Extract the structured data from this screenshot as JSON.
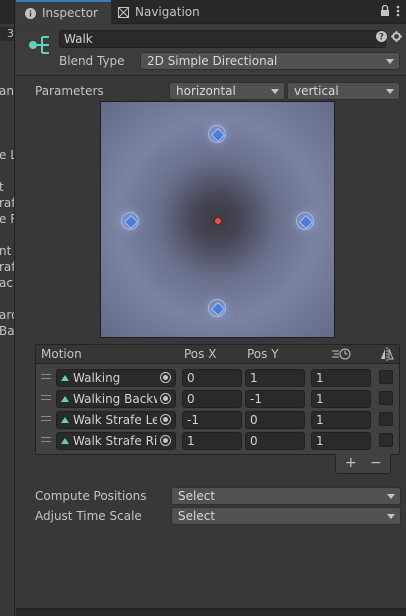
{
  "left_panel": {
    "number": "3",
    "fragments": [
      "and",
      "e L",
      "t",
      "rafe",
      "e R",
      "nt",
      "raf",
      "ack",
      "ard",
      "Ba"
    ]
  },
  "tabs": {
    "inspector": "Inspector",
    "navigation": "Navigation"
  },
  "header": {
    "name": "Walk",
    "blend_type_label": "Blend Type",
    "blend_type_value": "2D Simple Directional"
  },
  "parameters": {
    "label": "Parameters",
    "x_param": "horizontal",
    "y_param": "vertical"
  },
  "motion_list": {
    "headers": {
      "motion": "Motion",
      "pos_x": "Pos X",
      "pos_y": "Pos Y"
    },
    "rows": [
      {
        "motion": "Walking",
        "pos_x": "0",
        "pos_y": "1",
        "speed": "1"
      },
      {
        "motion": "Walking Backw",
        "pos_x": "0",
        "pos_y": "-1",
        "speed": "1"
      },
      {
        "motion": "Walk Strafe Lef",
        "pos_x": "-1",
        "pos_y": "0",
        "speed": "1"
      },
      {
        "motion": "Walk Strafe Rig",
        "pos_x": "1",
        "pos_y": "0",
        "speed": "1"
      }
    ],
    "add_label": "+",
    "remove_label": "−"
  },
  "compute_positions": {
    "label": "Compute Positions",
    "value": "Select"
  },
  "adjust_time_scale": {
    "label": "Adjust Time Scale",
    "value": "Select"
  },
  "colors": {
    "accent": "#3a79bb",
    "clip_icon": "#5fd2b9",
    "node": "#4a7ed8",
    "center_dot": "#e25555"
  }
}
